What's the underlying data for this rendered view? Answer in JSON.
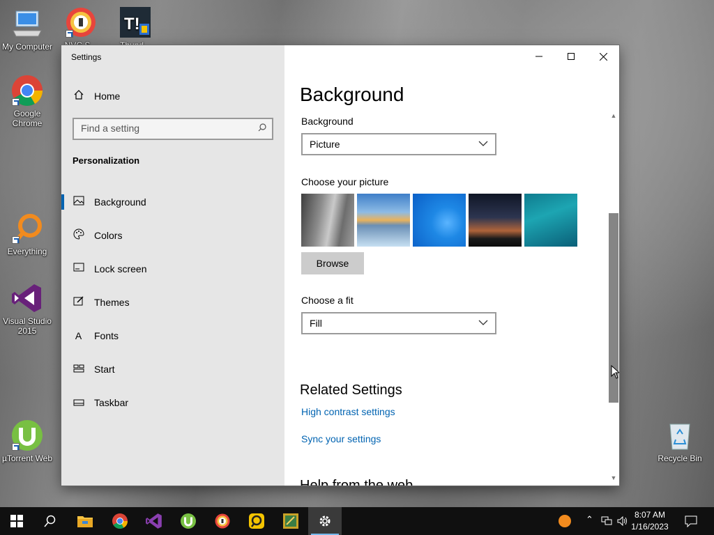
{
  "desktop": {
    "icons": [
      {
        "label": "My Computer"
      },
      {
        "label": "NVC S..."
      },
      {
        "label": "Thund..."
      },
      {
        "label": "Google Chrome"
      },
      {
        "label": "Everything"
      },
      {
        "label": "Visual Studio 2015"
      },
      {
        "label": "µTorrent Web"
      },
      {
        "label": "Recycle Bin"
      }
    ]
  },
  "window": {
    "title": "Settings",
    "minimize_icon": "minimize-icon",
    "maximize_icon": "maximize-icon",
    "close_icon": "close-icon"
  },
  "sidebar": {
    "home": "Home",
    "search_placeholder": "Find a setting",
    "section": "Personalization",
    "items": [
      {
        "label": "Background",
        "icon": "image-icon",
        "active": true
      },
      {
        "label": "Colors",
        "icon": "palette-icon"
      },
      {
        "label": "Lock screen",
        "icon": "lock-screen-icon"
      },
      {
        "label": "Themes",
        "icon": "themes-icon"
      },
      {
        "label": "Fonts",
        "icon": "fonts-icon"
      },
      {
        "label": "Start",
        "icon": "start-icon"
      },
      {
        "label": "Taskbar",
        "icon": "taskbar-icon"
      }
    ]
  },
  "main": {
    "title": "Background",
    "background_label": "Background",
    "background_value": "Picture",
    "choose_picture_label": "Choose your picture",
    "browse_label": "Browse",
    "fit_label": "Choose a fit",
    "fit_value": "Fill",
    "related_title": "Related Settings",
    "links": [
      "High contrast settings",
      "Sync your settings"
    ],
    "partial_heading": "Help from the web"
  },
  "taskbar": {
    "time": "8:07 AM",
    "date": "1/16/2023",
    "apps": [
      "start-icon",
      "search-icon",
      "file-explorer-icon",
      "chrome-icon",
      "visual-studio-icon",
      "utorrent-icon",
      "nvc-icon",
      "app-icon",
      "app2-icon",
      "settings-icon"
    ]
  },
  "colors": {
    "accent": "#0063b1",
    "sidebar_bg": "#e6e6e6",
    "taskbar_bg": "#101010"
  }
}
